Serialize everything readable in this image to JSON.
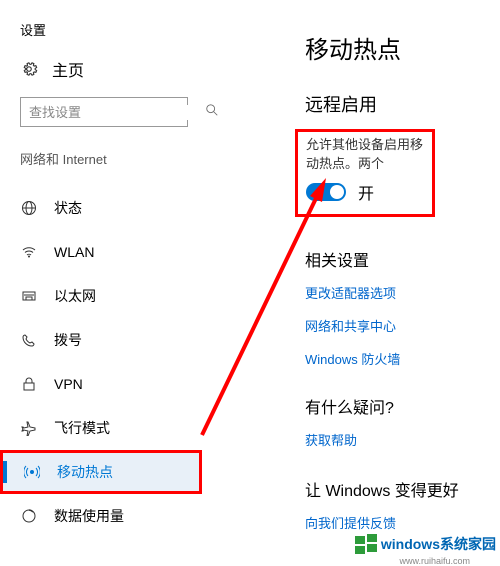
{
  "leftPanel": {
    "title": "设置",
    "home": "主页",
    "searchPlaceholder": "查找设置",
    "sectionLabel": "网络和 Internet",
    "nav": [
      {
        "label": "状态"
      },
      {
        "label": "WLAN"
      },
      {
        "label": "以太网"
      },
      {
        "label": "拨号"
      },
      {
        "label": "VPN"
      },
      {
        "label": "飞行模式"
      },
      {
        "label": "移动热点"
      },
      {
        "label": "数据使用量"
      }
    ]
  },
  "rightPanel": {
    "heading": "移动热点",
    "subheading": "远程启用",
    "desc": "允许其他设备启用移动热点。两个",
    "toggleLabel": "开",
    "relatedHeading": "相关设置",
    "relatedLinks": [
      "更改适配器选项",
      "网络和共享中心",
      "Windows 防火墙"
    ],
    "questionHeading": "有什么疑问?",
    "questionLink": "获取帮助",
    "betterHeading": "让 Windows 变得更好",
    "betterLink": "向我们提供反馈"
  },
  "watermark": {
    "text": "windows系统家园",
    "sub": "www.ruihaifu.com"
  }
}
